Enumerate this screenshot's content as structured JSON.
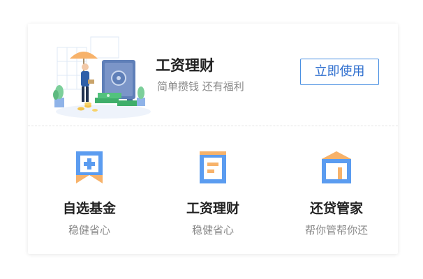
{
  "banner": {
    "title": "工资理财",
    "subtitle": "简单攒钱  还有福利",
    "button_label": "立即使用",
    "illustration": "person-umbrella-safe-money-illustration"
  },
  "items": [
    {
      "title": "自选基金",
      "subtitle": "稳健省心",
      "icon": "bookmark-plus-icon"
    },
    {
      "title": "工资理财",
      "subtitle": "稳健省心",
      "icon": "document-icon"
    },
    {
      "title": "还贷管家",
      "subtitle": "帮你管帮你还",
      "icon": "house-icon"
    }
  ],
  "colors": {
    "accent_blue": "#4a90e2",
    "icon_blue": "#5b9cf0",
    "icon_orange": "#f7b26a",
    "text_dark": "#222222",
    "text_gray": "#888888"
  }
}
